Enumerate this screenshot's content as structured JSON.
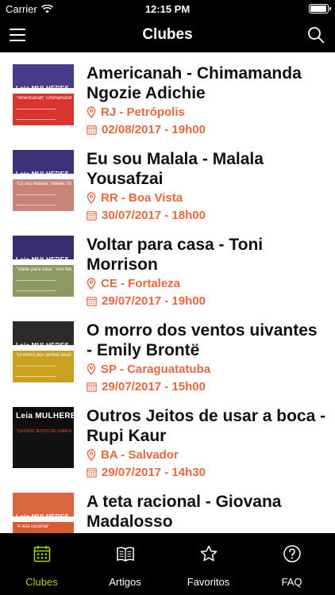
{
  "status_bar": {
    "carrier": "Carrier",
    "time": "12:15 PM",
    "battery_level": 0.95,
    "wifi_icon": "wifi-icon",
    "battery_icon": "battery-icon"
  },
  "navbar": {
    "title": "Clubes",
    "menu_icon": "hamburger-menu-icon",
    "search_icon": "search-icon"
  },
  "colors": {
    "accent_orange": "#e8683e",
    "tab_active": "#a8d300",
    "bar_background": "#000000"
  },
  "clubs": [
    {
      "title": "Americanah - Chimamanda Ngozie Adichie",
      "location": "RJ - Petrópolis",
      "datetime": "02/08/2017 - 19h00",
      "thumb_brand": "Leia MULHERES",
      "thumb_caption": "\"Americanah\" Chimamanda Ngozie Adichie",
      "thumb_top_color": "#4a3a8c",
      "thumb_bottom_color": "#d8352c"
    },
    {
      "title": "Eu sou Malala - Malala Yousafzai",
      "location": "RR - Boa Vista",
      "datetime": "30/07/2017 - 18h00",
      "thumb_brand": "Leia MULHERES",
      "thumb_caption": "\"Eu sou Malala\" Malala Yousafzai",
      "thumb_top_color": "#3d2f7a",
      "thumb_bottom_color": "#c9847a"
    },
    {
      "title": "Voltar para casa - Toni Morrison",
      "location": "CE - Fortaleza",
      "datetime": "29/07/2017 - 19h00",
      "thumb_brand": "Leia MULHERES",
      "thumb_caption": "\"Voltar para casa\" Toni Morrison",
      "thumb_top_color": "#3a2c70",
      "thumb_bottom_color": "#8e9a63"
    },
    {
      "title": "O morro dos ventos uivantes - Emily Brontë",
      "location": "SP - Caraguatatuba",
      "datetime": "29/07/2017 - 15h00",
      "thumb_brand": "Leia MULHERES",
      "thumb_caption": "\"O morro dos ventos uivantes\" Emily Brontë",
      "thumb_top_color": "#2d2a2a",
      "thumb_bottom_color": "#c9a11f"
    },
    {
      "title": "Outros Jeitos de usar a boca - Rupi Kaur",
      "location": "BA - Salvador",
      "datetime": "29/07/2017 - 14h30",
      "thumb_brand": "Leia MULHERES",
      "thumb_caption": "\"OUTROS JEITOS DE USAR A BOCA\" RUPI KAUR",
      "thumb_top_color": "#0d0d0d",
      "thumb_bottom_color": "#111111"
    },
    {
      "title": "A teta racional - Giovana Madalosso",
      "location": "",
      "datetime": "",
      "thumb_brand": "Leia MULHERES",
      "thumb_caption": "\"A teta racional\"",
      "thumb_top_color": "#d9663f",
      "thumb_bottom_color": "#d65a32"
    }
  ],
  "tabs": [
    {
      "label": "Clubes",
      "icon": "calendar-icon",
      "active": true
    },
    {
      "label": "Artigos",
      "icon": "book-icon",
      "active": false
    },
    {
      "label": "Favoritos",
      "icon": "star-icon",
      "active": false
    },
    {
      "label": "FAQ",
      "icon": "help-icon",
      "active": false
    }
  ]
}
